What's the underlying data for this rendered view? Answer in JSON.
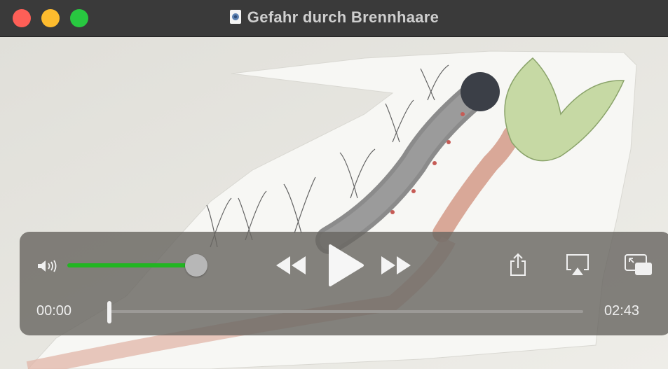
{
  "window": {
    "title": "Gefahr durch Brennhaare"
  },
  "video": {
    "content": "hand-drawn caterpillar on a plant stem, paper cutout on a wall"
  },
  "controls": {
    "current_time": "00:00",
    "duration": "02:43",
    "volume_level": 0.8,
    "progress": 0.0,
    "accent_color": "#22b522"
  }
}
